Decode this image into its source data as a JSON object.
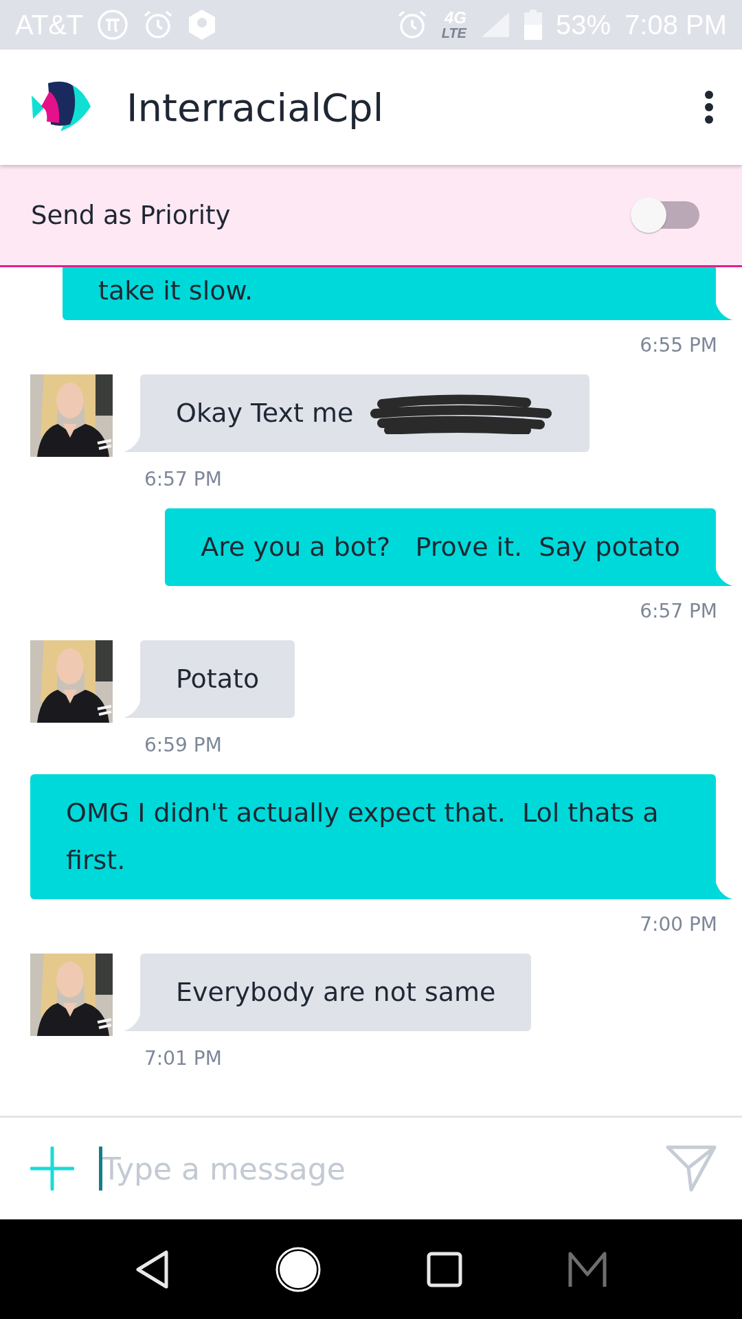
{
  "status_bar": {
    "carrier": "AT&T",
    "network": "4G",
    "network_sub": "LTE",
    "battery": "53%",
    "time": "7:08 PM"
  },
  "header": {
    "title": "InterracialCpl"
  },
  "priority": {
    "label": "Send as Priority",
    "on": false
  },
  "messages": [
    {
      "kind": "outgoing",
      "text": "take it slow.",
      "time": "6:55 PM"
    },
    {
      "kind": "incoming",
      "text": "Okay Text me",
      "redacted": true,
      "time": "6:57 PM"
    },
    {
      "kind": "outgoing",
      "text": "Are you a bot?   Prove it.  Say potato",
      "time": "6:57 PM"
    },
    {
      "kind": "incoming",
      "text": "Potato",
      "time": "6:59 PM"
    },
    {
      "kind": "outgoing",
      "text": "OMG I didn't actually expect that.  Lol thats a first.",
      "time": "7:00 PM"
    },
    {
      "kind": "incoming",
      "text": "Everybody are not same",
      "time": "7:01 PM"
    }
  ],
  "composer": {
    "placeholder": "Type a message"
  }
}
